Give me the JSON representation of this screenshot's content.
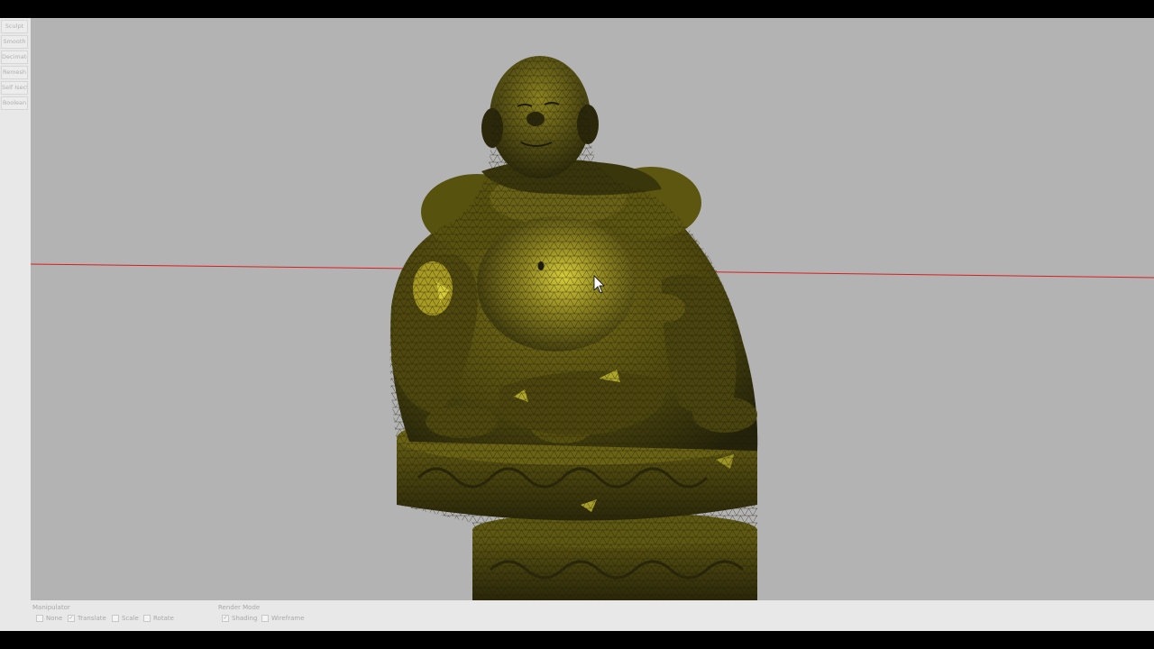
{
  "tools": {
    "items": [
      {
        "id": "sculpt",
        "label": "Sculpt"
      },
      {
        "id": "smooth",
        "label": "Smooth"
      },
      {
        "id": "decimate",
        "label": "Decimate"
      },
      {
        "id": "remesh",
        "label": "Remesh"
      },
      {
        "id": "self-isect",
        "label": "Self Isect"
      },
      {
        "id": "boolean",
        "label": "Boolean"
      }
    ]
  },
  "manipulator": {
    "title": "Manipulator",
    "options": [
      {
        "label": "None",
        "checked": false
      },
      {
        "label": "Translate",
        "checked": true
      },
      {
        "label": "Scale",
        "checked": false
      },
      {
        "label": "Rotate",
        "checked": false
      }
    ]
  },
  "render_mode": {
    "title": "Render Mode",
    "options": [
      {
        "label": "Shading",
        "checked": true
      },
      {
        "label": "Wireframe",
        "checked": false
      }
    ]
  },
  "check_glyph": "✓",
  "colors": {
    "viewport_bg": "#b3b3b3",
    "mesh_base": "#5a5410",
    "mesh_highlight": "#d6cc3a",
    "mesh_dark": "#1e1c08",
    "axis_line": "#d81e1e"
  }
}
